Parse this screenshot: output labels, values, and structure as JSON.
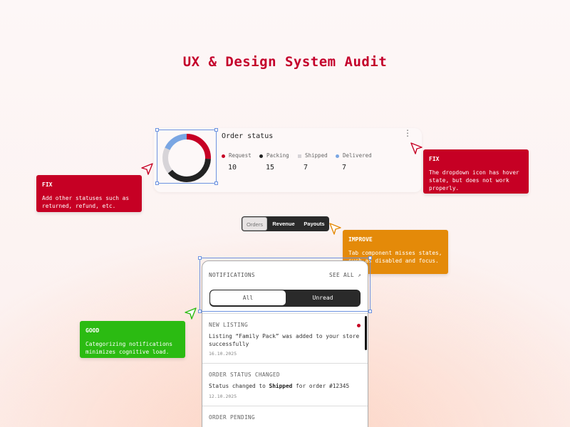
{
  "page": {
    "title": "UX & Design System Audit"
  },
  "order_status": {
    "title": "Order status",
    "menu_icon": "kebab-vertical-icon",
    "statuses": [
      {
        "label": "Request",
        "count": "10",
        "color": "#c60024",
        "marker": "dot"
      },
      {
        "label": "Packing",
        "count": "15",
        "color": "#222222",
        "marker": "dot"
      },
      {
        "label": "Shipped",
        "count": "7",
        "color": "#d7d4d8",
        "marker": "square"
      },
      {
        "label": "Delivered",
        "count": "7",
        "color": "#7aa6e3",
        "marker": "dot"
      }
    ]
  },
  "callouts": {
    "fix_dropdown": {
      "tag": "FIX",
      "text": "The dropdown icon has hover state, but does not work properly.",
      "color": "#c60024"
    },
    "fix_statuses": {
      "tag": "FIX",
      "text": "Add other statuses such as returned, refund, etc.",
      "color": "#c60024"
    },
    "improve_tabs": {
      "tag": "IMPROVE",
      "text": "Tab component misses states, such as disabled and focus.",
      "color": "#e48a09"
    },
    "good_categorizing": {
      "tag": "GOOD",
      "text": "Categorizing notifications minimizes cognitive load.",
      "color": "#2bbb12"
    }
  },
  "tabs": {
    "items": [
      "Orders",
      "Revenue",
      "Payouts"
    ],
    "selected": "Orders"
  },
  "notifications": {
    "header": "NOTIFICATIONS",
    "see_all": "SEE ALL",
    "see_all_icon": "arrow-right-icon",
    "segments": {
      "all": "All",
      "unread": "Unread",
      "selected": "All"
    },
    "items": [
      {
        "type": "NEW LISTING",
        "message": "Listing “Family Pack” was added to your store successfully",
        "date": "16.10.2025",
        "unread": true
      },
      {
        "type": "ORDER STATUS CHANGED",
        "message_prefix": "Status changed to ",
        "message_bold": "Shipped",
        "message_suffix": " for order #12345",
        "date": "12.10.2025",
        "unread": false
      },
      {
        "type": "ORDER PENDING",
        "message": "",
        "date": "",
        "unread": false
      }
    ]
  }
}
